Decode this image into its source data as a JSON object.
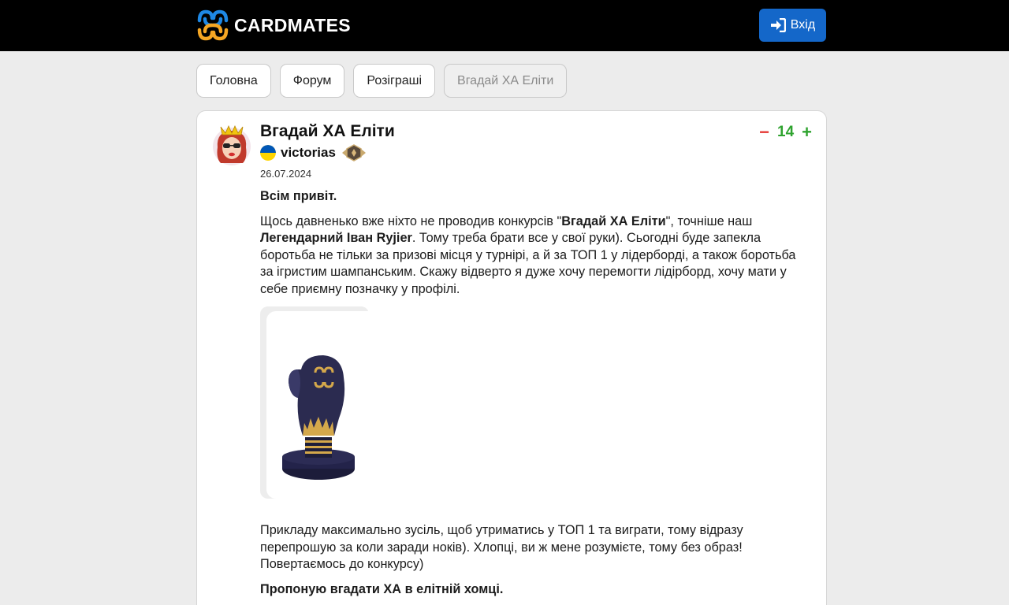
{
  "header": {
    "logo_text": "CARDMATES",
    "login_label": "Вхід"
  },
  "nav": {
    "tabs": [
      {
        "label": "Головна",
        "active": false
      },
      {
        "label": "Форум",
        "active": false
      },
      {
        "label": "Розіграші",
        "active": false
      },
      {
        "label": "Вгадай ХА Еліти",
        "active": true
      }
    ]
  },
  "post": {
    "title": "Вгадай ХА Еліти",
    "author": "victorias",
    "date": "26.07.2024",
    "score": "14",
    "vote_down": "−",
    "vote_up": "+",
    "paragraph1": "Всім привіт.",
    "paragraph2": {
      "t1": "Щось давненько вже ніхто не проводив конкурсів \"",
      "b1": "Вгадай ХА Еліти",
      "t2": "\", точніше наш ",
      "b2": "Легендарний Іван Ryjier",
      "t3": ". Тому треба брати все у свої руки). Сьогодні буде запекла боротьба не тільки за призові місця у турнірі, а й за ТОП 1 у лідерборді, а також боротьба за ігристим шампанським. Скажу відверто я дуже хочу перемогти лідірборд, хочу мати у себе приємну позначку у профілі."
    },
    "paragraph3": "Прикладу максимально зусіль, щоб утриматись у ТОП 1 та виграти, тому відразу перепрошую за коли заради ноків). Хлопці, ви ж мене розумієте, тому без образ! Повертаємось до конкурсу)",
    "paragraph4": "Пропоную вгадати ХА в елітній хомці."
  },
  "colors": {
    "header_bg": "#000000",
    "login_bg": "#1467c9",
    "score_green": "#2fa32f",
    "vote_down_red": "#e53935",
    "logo_blue": "#1e88e5",
    "logo_orange": "#f5a623"
  },
  "icons": [
    "cardmates-logo-icon",
    "sign-in-icon",
    "avatar",
    "ukraine-flag-icon",
    "rank-badge-icon",
    "boxing-glove-trophy"
  ]
}
